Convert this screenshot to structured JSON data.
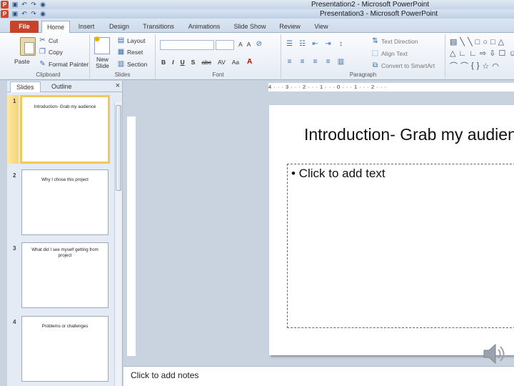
{
  "windows": {
    "back_title": "Presentation2 - Microsoft PowerPoint",
    "front_title": "Presentation3 - Microsoft PowerPoint",
    "app_icon_letter": "P"
  },
  "tabs": [
    "File",
    "Home",
    "Insert",
    "Design",
    "Transitions",
    "Animations",
    "Slide Show",
    "Review",
    "View"
  ],
  "ribbon": {
    "clipboard": {
      "paste": "Paste",
      "cut": "Cut",
      "copy": "Copy",
      "format_painter": "Format Painter",
      "label": "Clipboard"
    },
    "slides": {
      "new_slide_1": "New",
      "new_slide_2": "Slide",
      "layout": "Layout",
      "reset": "Reset",
      "section": "Section",
      "label": "Slides"
    },
    "font": {
      "label": "Font",
      "bold": "B",
      "italic": "I",
      "underline": "U",
      "strike": "S",
      "abc": "abc",
      "av": "AV",
      "aa": "Aa",
      "grow": "A",
      "shrink": "A"
    },
    "paragraph": {
      "text_direction": "Text Direction",
      "align_text": "Align Text",
      "convert_smartart": "Convert to SmartArt",
      "label": "Paragraph"
    }
  },
  "left_pane": {
    "tab_slides": "Slides",
    "tab_outline": "Outline",
    "close": "×",
    "slides": [
      {
        "num": "1",
        "title": "Introduction- Grab my audience"
      },
      {
        "num": "2",
        "title": "Why I chose this project"
      },
      {
        "num": "3",
        "title": "What did I see myself getting from project"
      },
      {
        "num": "4",
        "title": "Problems or challenges"
      }
    ]
  },
  "ruler": {
    "h": "4 · · · 3 · · · 2 · · · 1 · · · 0 · · · 1 · · · 2 · · ·"
  },
  "slide": {
    "title": "Introduction- Grab my audience",
    "placeholder_bullet": "• Click to add text"
  },
  "notes": {
    "placeholder": "Click to add notes"
  }
}
